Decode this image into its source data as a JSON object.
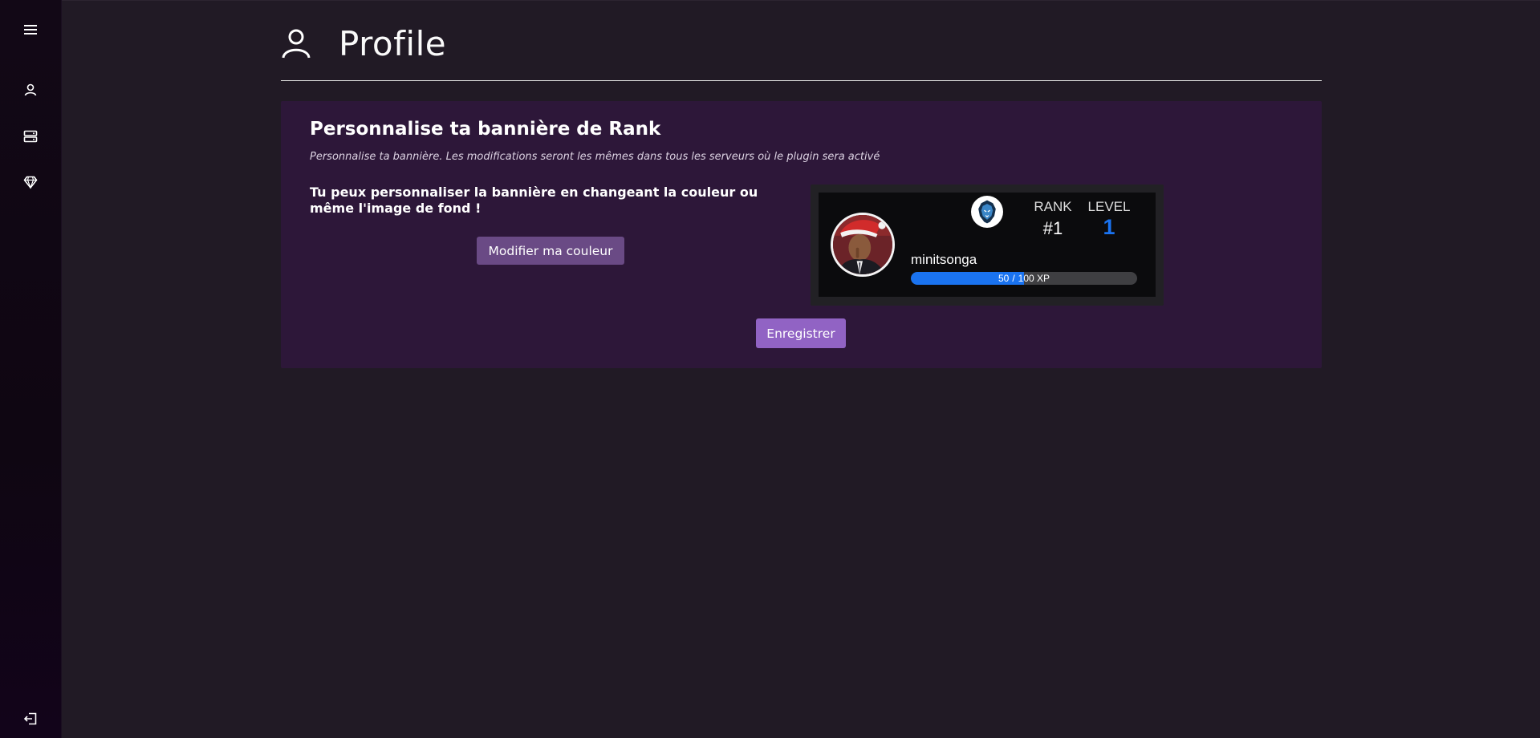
{
  "nav": {
    "items": [
      {
        "icon": "menu-icon"
      },
      {
        "icon": "user-icon"
      },
      {
        "icon": "server-icon"
      },
      {
        "icon": "diamond-icon"
      },
      {
        "icon": "logout-icon"
      }
    ]
  },
  "header": {
    "title": "Profile",
    "icon": "user-icon"
  },
  "card": {
    "title": "Personnalise ta bannière de Rank",
    "subtitle": "Personnalise ta bannière. Les modifications seront les mêmes dans tous les serveurs où le plugin sera activé",
    "description": "Tu peux personnaliser la bannière en changeant la couleur ou même l'image de fond !",
    "color_button_label": "Modifier ma couleur",
    "save_button_label": "Enregistrer"
  },
  "banner": {
    "rank_label": "RANK",
    "rank_value": "#1",
    "level_label": "LEVEL",
    "level_value": "1",
    "username": "minitsonga",
    "xp_current": "50",
    "xp_separator": "/",
    "xp_total": "100 XP",
    "xp_fraction": 0.5,
    "accent_color": "#1a73f0"
  },
  "colors": {
    "background": "#211a25",
    "card": "#2d1739",
    "primary_button": "#9163c4",
    "secondary_button": "#6a4a85"
  }
}
